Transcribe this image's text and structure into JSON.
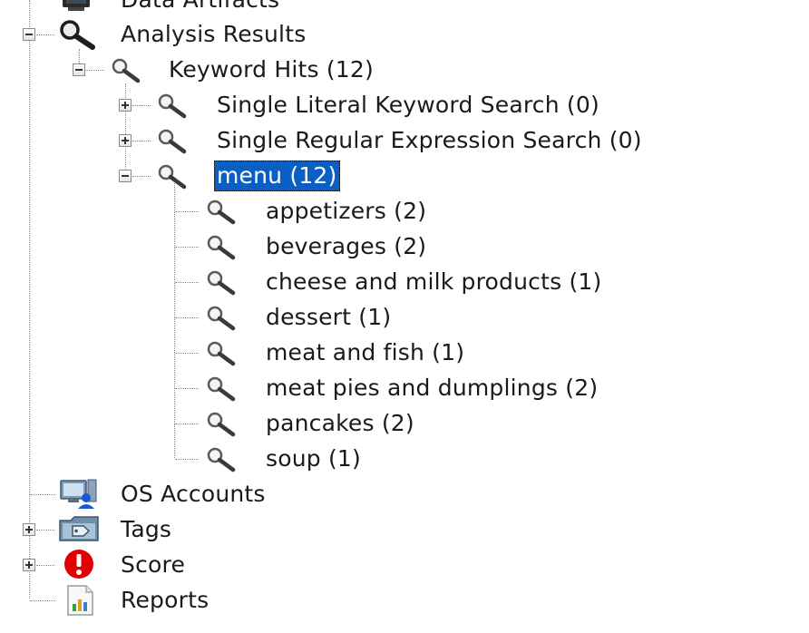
{
  "tree": {
    "nodes": [
      {
        "label": "Data Artifacts",
        "icon": "data-artifacts-icon"
      },
      {
        "label": "Analysis Results",
        "icon": "magnifier-icon",
        "state": "expanded"
      },
      {
        "label": "Keyword Hits (12)",
        "icon": "magnifier-icon",
        "state": "expanded"
      },
      {
        "label": "Single Literal Keyword Search (0)",
        "icon": "magnifier-icon",
        "state": "collapsed"
      },
      {
        "label": "Single Regular Expression Search (0)",
        "icon": "magnifier-icon",
        "state": "collapsed"
      },
      {
        "label": "menu (12)",
        "icon": "magnifier-icon",
        "state": "expanded",
        "selected": true
      },
      {
        "label": "appetizers (2)",
        "icon": "magnifier-icon"
      },
      {
        "label": "beverages (2)",
        "icon": "magnifier-icon"
      },
      {
        "label": "cheese and milk products (1)",
        "icon": "magnifier-icon"
      },
      {
        "label": "dessert (1)",
        "icon": "magnifier-icon"
      },
      {
        "label": "meat and fish (1)",
        "icon": "magnifier-icon"
      },
      {
        "label": "meat pies and dumplings (2)",
        "icon": "magnifier-icon"
      },
      {
        "label": "pancakes (2)",
        "icon": "magnifier-icon"
      },
      {
        "label": "soup (1)",
        "icon": "magnifier-icon"
      },
      {
        "label": "OS Accounts",
        "icon": "os-accounts-icon"
      },
      {
        "label": "Tags",
        "icon": "tag-icon",
        "state": "collapsed"
      },
      {
        "label": "Score",
        "icon": "alert-icon",
        "state": "collapsed"
      },
      {
        "label": "Reports",
        "icon": "report-icon"
      }
    ]
  },
  "colors": {
    "selection": "#0a5fc4",
    "score_alert": "#e00000"
  }
}
